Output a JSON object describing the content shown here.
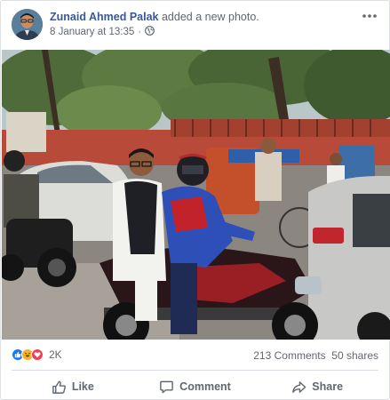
{
  "post": {
    "author": "Zunaid Ahmed Palak",
    "action": "added a new photo.",
    "timestamp": "8 January at 13:35",
    "separator": "·",
    "audience_icon": "globe-icon",
    "more_icon": "more-dots-icon"
  },
  "photo": {
    "subject": "photo"
  },
  "reactions": {
    "icons": [
      "like-reaction-icon",
      "haha-reaction-icon",
      "love-reaction-icon"
    ],
    "count": "2K",
    "comments": "213 Comments",
    "shares": "50 shares"
  },
  "actions": {
    "like": "Like",
    "comment": "Comment",
    "share": "Share"
  },
  "colors": {
    "link": "#385898",
    "meta": "#606770",
    "like_blue": "#1877f2",
    "love_red": "#f33e58",
    "haha_yellow": "#f7b125"
  }
}
